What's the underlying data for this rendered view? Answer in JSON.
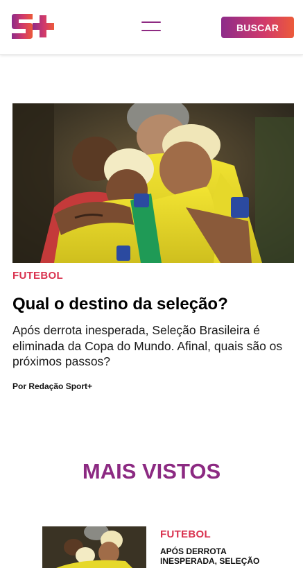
{
  "header": {
    "logo_text": "S+",
    "menu_icon": "hamburger-menu-icon",
    "search_label": "BUSCAR",
    "colors": {
      "brand_purple": "#8c2a82",
      "brand_pink": "#d23a6a",
      "brand_orange": "#ec5a3a"
    }
  },
  "featured": {
    "image": "players-embracing-photo",
    "category": "FUTEBOL",
    "title": "Qual o destino da seleção?",
    "summary": "Após derrota inesperada, Seleção Brasileira é eliminada da Copa do Mundo. Afinal, quais são os próximos passos?",
    "byline": "Por Redação Sport+",
    "category_color": "#d9324f"
  },
  "most_viewed": {
    "title": "MAIS VISTOS",
    "items": [
      {
        "image": "players-embracing-photo",
        "category": "FUTEBOL",
        "title": "APÓS DERROTA INESPERADA, SELEÇÃO"
      }
    ]
  }
}
